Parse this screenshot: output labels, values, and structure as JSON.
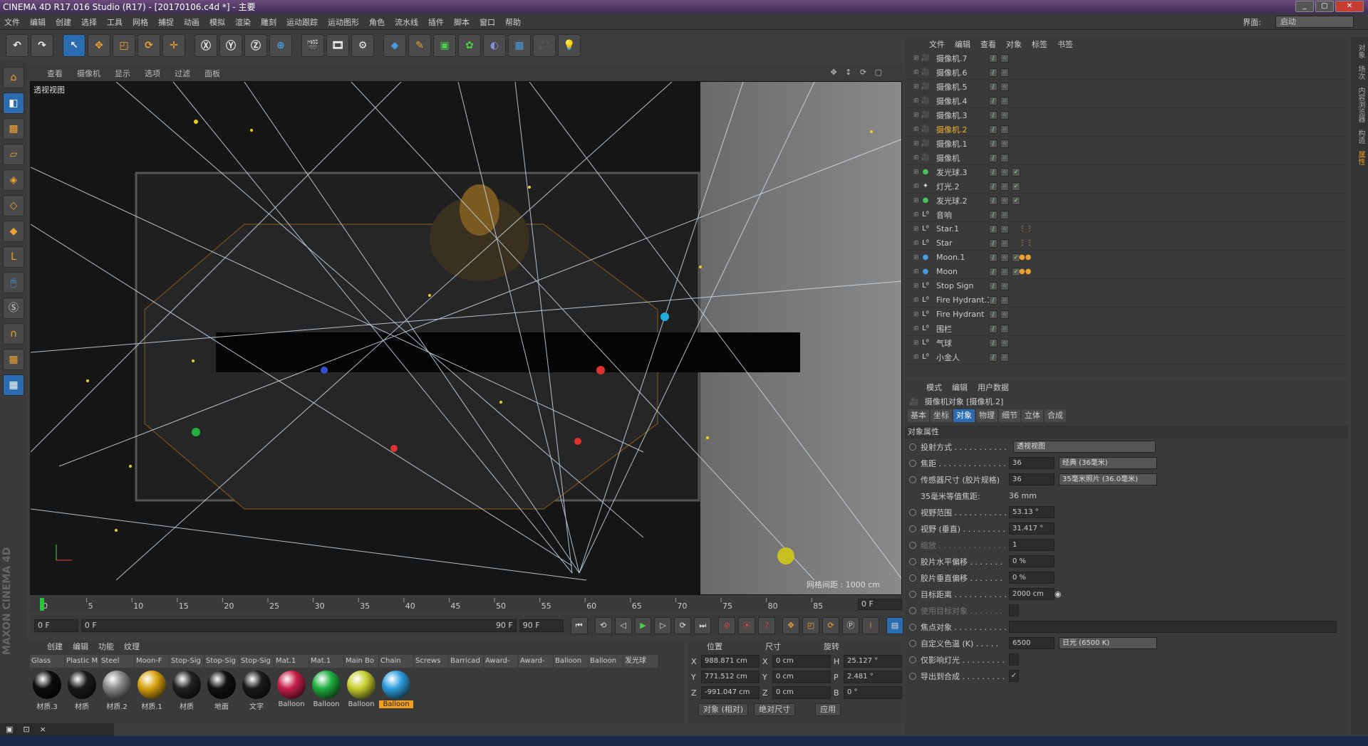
{
  "window": {
    "title": "CINEMA 4D R17.016 Studio (R17) - [20170106.c4d *] - 主要"
  },
  "menubar": {
    "items": [
      "文件",
      "编辑",
      "创建",
      "选择",
      "工具",
      "网格",
      "捕捉",
      "动画",
      "模拟",
      "渲染",
      "雕刻",
      "运动跟踪",
      "运动图形",
      "角色",
      "流水线",
      "插件",
      "脚本",
      "窗口",
      "帮助"
    ],
    "layout_label": "界面:",
    "layout_value": "启动"
  },
  "viewport": {
    "menu": [
      "查看",
      "摄像机",
      "显示",
      "选项",
      "过滤",
      "面板"
    ],
    "label": "透视视图",
    "grid": "网格间距 : 1000 cm",
    "nav_icons": "✥ ↕ ⟳ ▢"
  },
  "timeline": {
    "ticks": [
      "0",
      "5",
      "10",
      "15",
      "20",
      "25",
      "30",
      "35",
      "40",
      "45",
      "50",
      "55",
      "60",
      "65",
      "70",
      "75",
      "80",
      "85",
      "90"
    ],
    "frame": "0 F"
  },
  "playbar": {
    "start": "0 F",
    "range_start": "0 F",
    "range_end": "90 F",
    "end": "90 F"
  },
  "materials": {
    "menu": [
      "创建",
      "编辑",
      "功能",
      "纹理"
    ],
    "tabs": [
      "Glass",
      "Plastic M",
      "Steel",
      "Moon-F",
      "Stop-Sig",
      "Stop-Sig",
      "Stop-Sig",
      "Mat.1",
      "Mat.1",
      "Main Bo",
      "Chain",
      "Screws",
      "Barricad",
      "Award-",
      "Award-",
      "Balloon",
      "Balloon",
      "发光球"
    ],
    "items": [
      {
        "label": "材质.3",
        "color": "#0d0d0d"
      },
      {
        "label": "材质",
        "color": "#1a1a1a"
      },
      {
        "label": "材质.2",
        "color": "#8a8a8a"
      },
      {
        "label": "材质.1",
        "color": "#d9a410"
      },
      {
        "label": "材质",
        "color": "#222222"
      },
      {
        "label": "地面",
        "color": "#111111"
      },
      {
        "label": "文字",
        "color": "#1c1c1c"
      },
      {
        "label": "Balloon",
        "color": "#c8204a"
      },
      {
        "label": "Balloon",
        "color": "#20b040"
      },
      {
        "label": "Balloon",
        "color": "#c8d030"
      },
      {
        "label": "Balloon",
        "color": "#30a0e0",
        "active": true
      }
    ]
  },
  "coords": {
    "headers": [
      "位置",
      "尺寸",
      "旋转"
    ],
    "rows": [
      {
        "a": "X",
        "pos": "988.871 cm",
        "b": "X",
        "size": "0 cm",
        "c": "H",
        "rot": "25.127 °"
      },
      {
        "a": "Y",
        "pos": "771.512 cm",
        "b": "Y",
        "size": "0 cm",
        "c": "P",
        "rot": "2.481 °"
      },
      {
        "a": "Z",
        "pos": "-991.047 cm",
        "b": "Z",
        "size": "0 cm",
        "c": "B",
        "rot": "0 °"
      }
    ],
    "mode": "对象 (相对)",
    "size_mode": "绝对尺寸",
    "apply": "应用"
  },
  "taskwin": [
    "▣",
    "⊡",
    "×"
  ],
  "objmgr": {
    "menu": [
      "文件",
      "编辑",
      "查看",
      "对象",
      "标签",
      "书签"
    ],
    "items": [
      {
        "name": "摄像机.7",
        "icon": "cam-icon"
      },
      {
        "name": "摄像机.6",
        "icon": "cam-icon"
      },
      {
        "name": "摄像机.5",
        "icon": "cam-icon"
      },
      {
        "name": "摄像机.4",
        "icon": "cam-icon"
      },
      {
        "name": "摄像机.3",
        "icon": "cam-icon"
      },
      {
        "name": "摄像机.2",
        "icon": "cam-icon",
        "active": true
      },
      {
        "name": "摄像机.1",
        "icon": "cam-icon"
      },
      {
        "name": "摄像机",
        "icon": "cam-icon"
      },
      {
        "name": "发光球.3",
        "icon": "sphere-icon",
        "check": "✓"
      },
      {
        "name": "灯光.2",
        "icon": "light-icon",
        "check": "✓"
      },
      {
        "name": "发光球.2",
        "icon": "sphere-icon",
        "check": "✓"
      },
      {
        "name": "音响",
        "icon": "null-icon"
      },
      {
        "name": "Star.1",
        "icon": "null-icon",
        "tag": "⋮⋮"
      },
      {
        "name": "Star",
        "icon": "null-icon",
        "tag": "⋮⋮"
      },
      {
        "name": "Moon.1",
        "icon": "sphere-icon",
        "check": "✓",
        "tag": "●●"
      },
      {
        "name": "Moon",
        "icon": "sphere-icon",
        "check": "✓",
        "tag": "●●"
      },
      {
        "name": "Stop Sign",
        "icon": "null-icon"
      },
      {
        "name": "Fire Hydrant.1",
        "icon": "null-icon"
      },
      {
        "name": "Fire Hydrant",
        "icon": "null-icon"
      },
      {
        "name": "围栏",
        "icon": "null-icon"
      },
      {
        "name": "气球",
        "icon": "null-icon"
      },
      {
        "name": "小金人",
        "icon": "null-icon"
      }
    ]
  },
  "attr": {
    "menu": [
      "模式",
      "编辑",
      "用户数据"
    ],
    "title": "摄像机对象 [摄像机.2]",
    "tabs": [
      "基本",
      "坐标",
      "对象",
      "物理",
      "细节",
      "立体",
      "合成"
    ],
    "active_tab": 2,
    "section": "对象属性",
    "rows": [
      {
        "label": "投射方式 . . . . . . . . . . .",
        "value": "",
        "dropdown": "透视视图"
      },
      {
        "label": "焦距 . . . . . . . . . . . . . . .",
        "value": "36",
        "dropdown": "经典 (36毫米)"
      },
      {
        "label": "传感器尺寸 (胶片规格)",
        "value": "36",
        "dropdown": "35毫米照片 (36.0毫米)"
      },
      {
        "label": "35毫米等值焦距:",
        "value": "36 mm",
        "plain": true
      },
      {
        "label": "视野范围 . . . . . . . . . . .",
        "value": "53.13 °"
      },
      {
        "label": "视野 (垂直) . . . . . . . . .",
        "value": "31.417 °"
      },
      {
        "label": "缩放 . . . . . . . . . . . . . . .",
        "value": "1",
        "dim": true
      },
      {
        "label": "胶片水平偏移 . . . . . . .",
        "value": "0 %"
      },
      {
        "label": "胶片垂直偏移 . . . . . . .",
        "value": "0 %"
      },
      {
        "label": "目标距离 . . . . . . . . . . .",
        "value": "2000 cm"
      },
      {
        "label": "使用目标对象 . . . . . . .",
        "value": "",
        "dim": true
      },
      {
        "label": "焦点对象 . . . . . . . . . . .",
        "value": ""
      },
      {
        "label": "自定义色温 (K) . . . . .",
        "value": "6500",
        "dropdown": "日光 (6500 K)"
      },
      {
        "label": "仅影响灯光 . . . . . . . . .",
        "value": ""
      },
      {
        "label": "导出到合成 . . . . . . . . .",
        "value": "✓"
      }
    ]
  },
  "right_strip": [
    "对象",
    "场次",
    "内容浏览器",
    "构造",
    "属性"
  ]
}
